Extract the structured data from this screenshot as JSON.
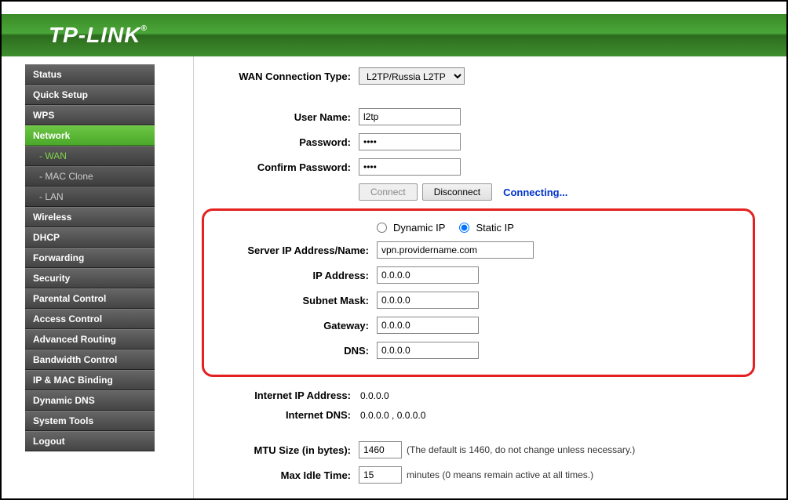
{
  "brand": "TP-LINK",
  "sidebar": {
    "items": [
      {
        "label": "Status",
        "kind": "main"
      },
      {
        "label": "Quick Setup",
        "kind": "main"
      },
      {
        "label": "WPS",
        "kind": "main"
      },
      {
        "label": "Network",
        "kind": "main",
        "active": true
      },
      {
        "label": "- WAN",
        "kind": "sub",
        "active": true
      },
      {
        "label": "- MAC Clone",
        "kind": "sub"
      },
      {
        "label": "- LAN",
        "kind": "sub"
      },
      {
        "label": "Wireless",
        "kind": "main"
      },
      {
        "label": "DHCP",
        "kind": "main"
      },
      {
        "label": "Forwarding",
        "kind": "main"
      },
      {
        "label": "Security",
        "kind": "main"
      },
      {
        "label": "Parental Control",
        "kind": "main"
      },
      {
        "label": "Access Control",
        "kind": "main"
      },
      {
        "label": "Advanced Routing",
        "kind": "main"
      },
      {
        "label": "Bandwidth Control",
        "kind": "main"
      },
      {
        "label": "IP & MAC Binding",
        "kind": "main"
      },
      {
        "label": "Dynamic DNS",
        "kind": "main"
      },
      {
        "label": "System Tools",
        "kind": "main"
      },
      {
        "label": "Logout",
        "kind": "main"
      }
    ]
  },
  "form": {
    "wan_type_label": "WAN Connection Type:",
    "wan_type_value": "L2TP/Russia L2TP",
    "username_label": "User Name:",
    "username_value": "l2tp",
    "password_label": "Password:",
    "password_value": "****",
    "confirm_label": "Confirm Password:",
    "confirm_value": "****",
    "connect_label": "Connect",
    "disconnect_label": "Disconnect",
    "status_text": "Connecting...",
    "dynamic_ip_label": "Dynamic IP",
    "static_ip_label": "Static IP",
    "ip_mode": "static",
    "server_label": "Server IP Address/Name:",
    "server_value": "vpn.providername.com",
    "ip_label": "IP Address:",
    "ip_value": "0.0.0.0",
    "mask_label": "Subnet Mask:",
    "mask_value": "0.0.0.0",
    "gateway_label": "Gateway:",
    "gateway_value": "0.0.0.0",
    "dns_label": "DNS:",
    "dns_value": "0.0.0.0",
    "internet_ip_label": "Internet IP Address:",
    "internet_ip_value": "0.0.0.0",
    "internet_dns_label": "Internet DNS:",
    "internet_dns_value": "0.0.0.0 , 0.0.0.0",
    "mtu_label": "MTU Size (in bytes):",
    "mtu_value": "1460",
    "mtu_hint": "(The default is 1460, do not change unless necessary.)",
    "idle_label": "Max Idle Time:",
    "idle_value": "15",
    "idle_hint": "minutes (0 means remain active at all times.)"
  }
}
